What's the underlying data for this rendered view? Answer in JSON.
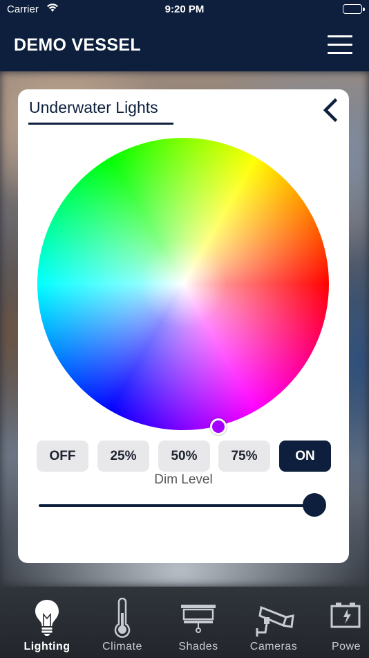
{
  "status_bar": {
    "carrier": "Carrier",
    "time": "9:20 PM"
  },
  "header": {
    "title": "DEMO VESSEL",
    "menu_icon": "hamburger-menu-icon"
  },
  "card": {
    "title": "Underwater Lights",
    "back_icon": "chevron-left-icon",
    "color_wheel": {
      "selected_color": "#a500ff"
    },
    "preset_buttons": [
      {
        "label": "OFF",
        "active": false
      },
      {
        "label": "25%",
        "active": false
      },
      {
        "label": "50%",
        "active": false
      },
      {
        "label": "75%",
        "active": false
      },
      {
        "label": "ON",
        "active": true
      }
    ],
    "dim_label": "Dim Level",
    "dim_level_fraction": 1.0
  },
  "tabs": [
    {
      "label": "Lighting",
      "icon": "lightbulb-icon",
      "active": true
    },
    {
      "label": "Climate",
      "icon": "thermometer-icon",
      "active": false
    },
    {
      "label": "Shades",
      "icon": "shade-icon",
      "active": false
    },
    {
      "label": "Cameras",
      "icon": "security-camera-icon",
      "active": false
    },
    {
      "label": "Powe",
      "icon": "battery-icon",
      "active": false
    }
  ],
  "colors": {
    "navy": "#0d1f3c",
    "button_bg": "#e8e8ea",
    "tabbar_bg": "#2a2e34"
  }
}
